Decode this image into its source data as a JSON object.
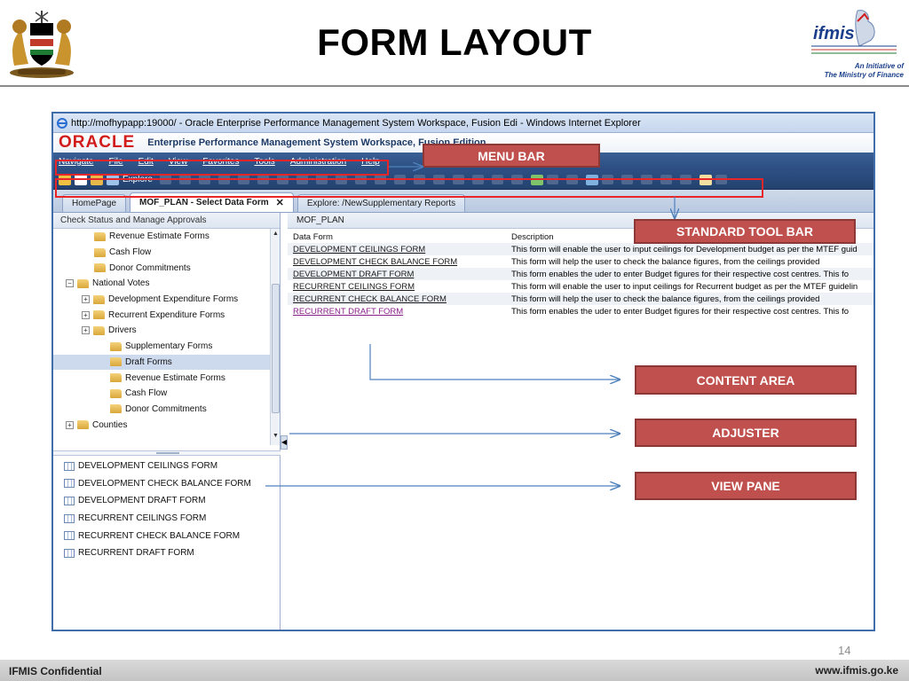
{
  "slide": {
    "title": "FORM LAYOUT",
    "ifmis_tagline_1": "An Initiative of",
    "ifmis_tagline_2": "The Ministry of Finance",
    "slide_number": "14",
    "footer_left": "IFMIS Confidential",
    "footer_right": "www.ifmis.go.ke"
  },
  "browser": {
    "title": "http://mofhypapp:19000/ - Oracle Enterprise Performance Management System Workspace, Fusion Edi - Windows Internet Explorer",
    "oracle_logo": "ORACLE",
    "app_name": "Enterprise Performance Management System Workspace, Fusion Edition"
  },
  "menu": [
    "Navigate",
    "File",
    "Edit",
    "View",
    "Favorites",
    "Tools",
    "Administration",
    "Help"
  ],
  "toolbar": {
    "explore_label": "Explore"
  },
  "tabs": [
    {
      "label": "HomePage"
    },
    {
      "label": "MOF_PLAN - Select Data Form",
      "close": "✕"
    },
    {
      "label": "Explore: /NewSupplementary Reports"
    }
  ],
  "left_pane": {
    "header": "Check Status and Manage Approvals",
    "tree": [
      {
        "label": "Revenue Estimate Forms",
        "indent": 1,
        "toggle": ""
      },
      {
        "label": "Cash Flow",
        "indent": 1,
        "toggle": ""
      },
      {
        "label": "Donor Commitments",
        "indent": 1,
        "toggle": ""
      },
      {
        "label": "National Votes",
        "indent": 0,
        "toggle": "−"
      },
      {
        "label": "Development Expenditure Forms",
        "indent": 1,
        "toggle": "+"
      },
      {
        "label": "Recurrent Expenditure Forms",
        "indent": 1,
        "toggle": "+"
      },
      {
        "label": "Drivers",
        "indent": 1,
        "toggle": "+"
      },
      {
        "label": "Supplementary Forms",
        "indent": 2,
        "toggle": ""
      },
      {
        "label": "Draft Forms",
        "indent": 2,
        "toggle": "",
        "selected": true
      },
      {
        "label": "Revenue Estimate Forms",
        "indent": 2,
        "toggle": ""
      },
      {
        "label": "Cash Flow",
        "indent": 2,
        "toggle": ""
      },
      {
        "label": "Donor Commitments",
        "indent": 2,
        "toggle": ""
      },
      {
        "label": "Counties",
        "indent": 0,
        "toggle": "+"
      }
    ]
  },
  "view_pane": {
    "items": [
      "DEVELOPMENT CEILINGS FORM",
      "DEVELOPMENT CHECK BALANCE FORM",
      "DEVELOPMENT DRAFT FORM",
      "RECURRENT CEILINGS FORM",
      "RECURRENT CHECK BALANCE FORM",
      "RECURRENT DRAFT FORM"
    ]
  },
  "content": {
    "header": "MOF_PLAN",
    "columns": {
      "form": "Data Form",
      "description": "Description"
    },
    "rows": [
      {
        "form": "DEVELOPMENT CEILINGS FORM",
        "description": "This form will enable the user to input ceilings for Development budget as per the MTEF guid"
      },
      {
        "form": "DEVELOPMENT CHECK BALANCE FORM",
        "description": "This form will help the user to check the balance figures, from the ceilings provided"
      },
      {
        "form": "DEVELOPMENT DRAFT FORM",
        "description": "This form enables the uder to enter Budget figures for their respective cost centres. This fo"
      },
      {
        "form": "RECURRENT CEILINGS FORM",
        "description": "This form will enable the user to input ceilings for Recurrent budget as per the MTEF guidelin"
      },
      {
        "form": "RECURRENT CHECK BALANCE FORM",
        "description": "This form will help the user to check the balance figures, from the ceilings provided"
      },
      {
        "form": "RECURRENT DRAFT FORM",
        "description": "This form enables the uder to enter Budget figures for their respective cost centres. This fo",
        "visited": true
      }
    ]
  },
  "callouts": {
    "menu_bar": "MENU BAR",
    "standard_tool_bar": "STANDARD TOOL BAR",
    "content_area": "CONTENT AREA",
    "adjuster": "ADJUSTER",
    "view_pane": "VIEW PANE"
  },
  "colors": {
    "callout": "#c0504d",
    "highlight": "#e8262a",
    "arrow": "#4f81bd",
    "menubar": "#2b4d80",
    "oracle_red": "#d21b1b"
  }
}
